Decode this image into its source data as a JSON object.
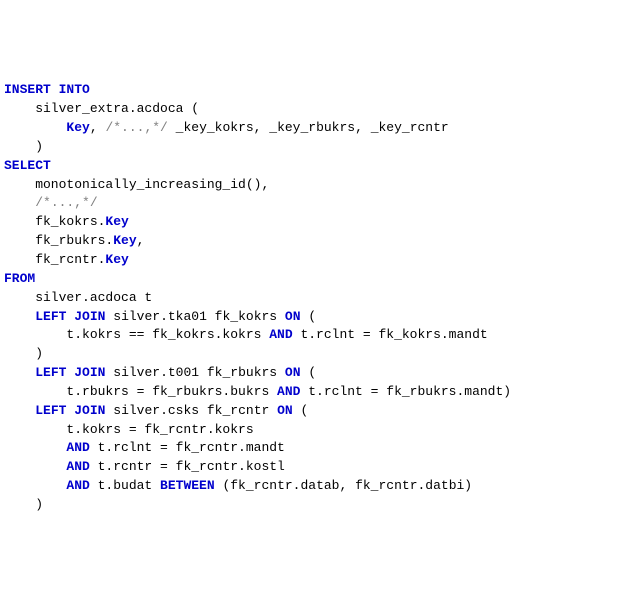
{
  "code": {
    "l1": {
      "kw1": "INSERT",
      "kw2": "INTO"
    },
    "l2": {
      "txt": "    silver_extra.acdoca ("
    },
    "l3": {
      "indent": "        ",
      "kw": "Key",
      "sep": ", ",
      "cmt": "/*...,*/",
      "rest": " _key_kokrs, _key_rbukrs, _key_rcntr"
    },
    "l4": {
      "txt": "    )"
    },
    "l5": {
      "kw": "SELECT"
    },
    "l6": {
      "txt": "    monotonically_increasing_id(),"
    },
    "l7": {
      "indent": "    ",
      "cmt": "/*...,*/"
    },
    "l8a": {
      "txt": "    fk_kokrs."
    },
    "l8b": {
      "kw": "Key"
    },
    "l9a": {
      "txt": "    fk_rbukrs."
    },
    "l9b": {
      "kw": "Key"
    },
    "l9c": {
      "txt": ","
    },
    "l10a": {
      "txt": "    fk_rcntr."
    },
    "l10b": {
      "kw": "Key"
    },
    "l11": {
      "kw": "FROM"
    },
    "l12": {
      "txt": "    silver.acdoca t"
    },
    "l13a": {
      "indent": "    ",
      "kw1": "LEFT",
      "kw2": "JOIN",
      "mid": " silver.tka01 fk_kokrs ",
      "kw3": "ON",
      "end": " ("
    },
    "l14a": {
      "indent": "        t.kokrs == fk_kokrs.kokrs ",
      "kw": "AND",
      "end": " t.rclnt = fk_kokrs.mandt"
    },
    "l15": {
      "txt": "    )"
    },
    "l16a": {
      "indent": "    ",
      "kw1": "LEFT",
      "kw2": "JOIN",
      "mid": " silver.t001 fk_rbukrs ",
      "kw3": "ON",
      "end": " ("
    },
    "l17a": {
      "indent": "        t.rbukrs = fk_rbukrs.bukrs ",
      "kw": "AND",
      "end": " t.rclnt = fk_rbukrs.mandt)"
    },
    "l18a": {
      "indent": "    ",
      "kw1": "LEFT",
      "kw2": "JOIN",
      "mid": " silver.csks fk_rcntr ",
      "kw3": "ON",
      "end": " ("
    },
    "l19": {
      "txt": "        t.kokrs = fk_rcntr.kokrs"
    },
    "l20a": {
      "indent": "        ",
      "kw": "AND",
      "end": " t.rclnt = fk_rcntr.mandt"
    },
    "l21a": {
      "indent": "        ",
      "kw": "AND",
      "end": " t.rcntr = fk_rcntr.kostl"
    },
    "l22a": {
      "indent": "        ",
      "kw1": "AND",
      "mid": " t.budat ",
      "kw2": "BETWEEN",
      "end": " (fk_rcntr.datab, fk_rcntr.datbi)"
    },
    "l23": {
      "txt": "    )"
    }
  }
}
